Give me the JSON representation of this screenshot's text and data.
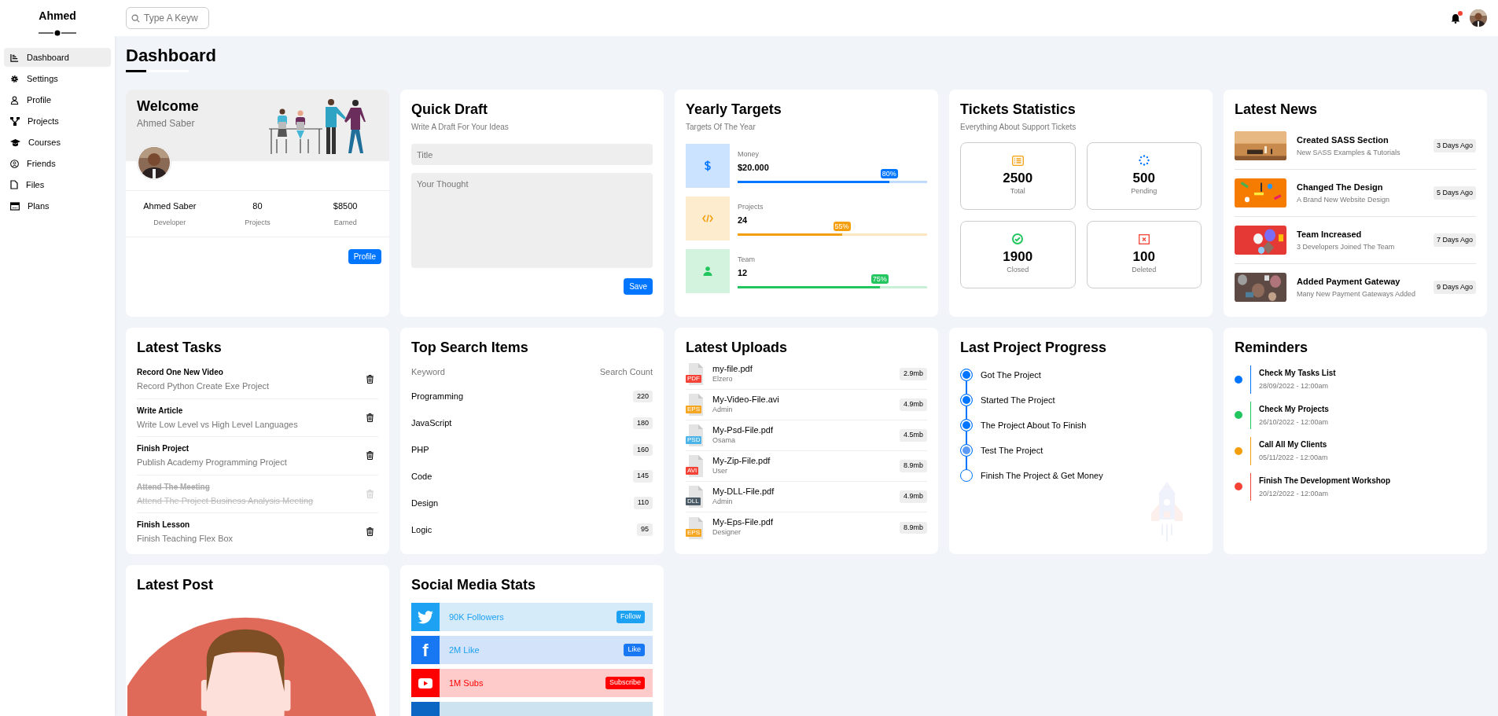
{
  "sidebar": {
    "brand": "Ahmed",
    "items": [
      {
        "label": "Dashboard",
        "selected": true
      },
      {
        "label": "Settings",
        "selected": false
      },
      {
        "label": "Profile",
        "selected": false
      },
      {
        "label": "Projects",
        "selected": false
      },
      {
        "label": "Courses",
        "selected": false
      },
      {
        "label": "Friends",
        "selected": false
      },
      {
        "label": "Files",
        "selected": false
      },
      {
        "label": "Plans",
        "selected": false
      }
    ]
  },
  "topbar": {
    "search": {
      "placeholder": "Type A Keyw"
    },
    "notification": true
  },
  "page_title": "Dashboard",
  "welcome": {
    "title": "Welcome",
    "subtitle": "Ahmed Saber",
    "stats": [
      {
        "value": "Ahmed Saber",
        "label": "Developer"
      },
      {
        "value": "80",
        "label": "Projects"
      },
      {
        "value": "$8500",
        "label": "Earned"
      }
    ],
    "button": "Profile"
  },
  "quick_draft": {
    "title": "Quick Draft",
    "subtitle": "Write A Draft For Your Ideas",
    "title_placeholder": "Title",
    "body_placeholder": "Your Thought",
    "button": "Save"
  },
  "yearly_targets": {
    "title": "Yearly Targets",
    "subtitle": "Targets Of The Year",
    "items": [
      {
        "label": "Money",
        "value": "$20.000",
        "badge": "80%",
        "level": 0.8,
        "color": "#0075ff"
      },
      {
        "label": "Projects",
        "value": "24",
        "badge": "55%",
        "level": 0.55,
        "color": "#f59e0b"
      },
      {
        "label": "Team",
        "value": "12",
        "badge": "75%",
        "level": 0.75,
        "color": "#22c55e"
      }
    ]
  },
  "tickets": {
    "title": "Tickets Statistics",
    "subtitle": "Everything About Support Tickets",
    "items": [
      {
        "value": "2500",
        "label": "Total",
        "color": "#f59e0b"
      },
      {
        "value": "500",
        "label": "Pending",
        "color": "#0075ff"
      },
      {
        "value": "1900",
        "label": "Closed",
        "color": "#22c55e"
      },
      {
        "value": "100",
        "label": "Deleted",
        "color": "#f44336"
      }
    ]
  },
  "latest_news": {
    "title": "Latest News",
    "items": [
      {
        "title": "Created SASS Section",
        "description": "New SASS Examples & Tutorials",
        "time": "3 Days Ago"
      },
      {
        "title": "Changed The Design",
        "description": "A Brand New Website Design",
        "time": "5 Days Ago"
      },
      {
        "title": "Team Increased",
        "description": "3 Developers Joined The Team",
        "time": "7 Days Ago"
      },
      {
        "title": "Added Payment Gateway",
        "description": "Many New Payment Gateways Added",
        "time": "9 Days Ago"
      }
    ]
  },
  "latest_tasks": {
    "title": "Latest Tasks",
    "items": [
      {
        "title": "Record One New Video",
        "description": "Record Python Create Exe Project",
        "done": false
      },
      {
        "title": "Write Article",
        "description": "Write Low Level vs High Level Languages",
        "done": false
      },
      {
        "title": "Finish Project",
        "description": "Publish Academy Programming Project",
        "done": false
      },
      {
        "title": "Attend The Meeting",
        "description": "Attend The Project Business Analysis Meeting",
        "done": true
      },
      {
        "title": "Finish Lesson",
        "description": "Finish Teaching Flex Box",
        "done": false
      }
    ]
  },
  "top_search": {
    "title": "Top Search Items",
    "columns": [
      "Keyword",
      "Search Count"
    ],
    "rows": [
      {
        "keyword": "Programming",
        "count": "220"
      },
      {
        "keyword": "JavaScript",
        "count": "180"
      },
      {
        "keyword": "PHP",
        "count": "160"
      },
      {
        "keyword": "Code",
        "count": "145"
      },
      {
        "keyword": "Design",
        "count": "110"
      },
      {
        "keyword": "Logic",
        "count": "95"
      }
    ]
  },
  "latest_uploads": {
    "title": "Latest Uploads",
    "items": [
      {
        "name": "my-file.pdf",
        "owner": "Elzero",
        "size": "2.9mb",
        "type": "PDF",
        "color": "#f44336"
      },
      {
        "name": "My-Video-File.avi",
        "owner": "Admin",
        "size": "4.9mb",
        "type": "EPS",
        "color": "#f5a623"
      },
      {
        "name": "My-Psd-File.pdf",
        "owner": "Osama",
        "size": "4.5mb",
        "type": "PSD",
        "color": "#4ab3e8"
      },
      {
        "name": "My-Zip-File.pdf",
        "owner": "User",
        "size": "8.9mb",
        "type": "AVI",
        "color": "#f44336"
      },
      {
        "name": "My-DLL-File.pdf",
        "owner": "Admin",
        "size": "4.9mb",
        "type": "DLL",
        "color": "#4a5a66"
      },
      {
        "name": "My-Eps-File.pdf",
        "owner": "Designer",
        "size": "8.9mb",
        "type": "EPS",
        "color": "#f5a623"
      }
    ]
  },
  "project_progress": {
    "title": "Last Project Progress",
    "steps": [
      {
        "label": "Got The Project",
        "done": true,
        "current": false
      },
      {
        "label": "Started The Project",
        "done": true,
        "current": false
      },
      {
        "label": "The Project About To Finish",
        "done": true,
        "current": false
      },
      {
        "label": "Test The Project",
        "done": false,
        "current": true
      },
      {
        "label": "Finish The Project & Get Money",
        "done": false,
        "current": false
      }
    ]
  },
  "reminders": {
    "title": "Reminders",
    "items": [
      {
        "title": "Check My Tasks List",
        "date": "28/09/2022 - 12:00am",
        "color": "#0075ff"
      },
      {
        "title": "Check My Projects",
        "date": "26/10/2022 - 12:00am",
        "color": "#22c55e"
      },
      {
        "title": "Call All My Clients",
        "date": "05/11/2022 - 12:00am",
        "color": "#f59e0b"
      },
      {
        "title": "Finish The Development Workshop",
        "date": "20/12/2022 - 12:00am",
        "color": "#f44336"
      }
    ]
  },
  "latest_post": {
    "title": "Latest Post"
  },
  "social": {
    "title": "Social Media Stats",
    "items": [
      {
        "kind": "twitter",
        "text": "90K Followers",
        "button": "Follow"
      },
      {
        "kind": "facebook",
        "glyph": "f",
        "text": "2M Like",
        "button": "Like"
      },
      {
        "kind": "youtube",
        "text": "1M Subs",
        "button": "Subscribe"
      },
      {
        "kind": "linkedin"
      }
    ]
  }
}
